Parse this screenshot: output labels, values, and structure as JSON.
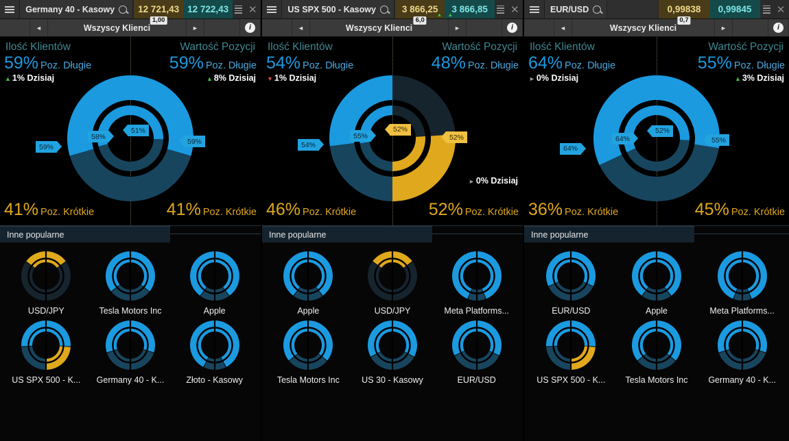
{
  "nav": {
    "clients_label": "Wszyscy Klienci",
    "prev_icon": "◄",
    "next_icon": "►",
    "info_icon": "i"
  },
  "labels": {
    "clients_count": "Ilość Klientów",
    "position_value": "Wartość Pozycji",
    "long": "Poz. Długie",
    "short": "Poz. Krótkie",
    "today": "Dzisiaj",
    "popular": "Inne popularne"
  },
  "colors": {
    "long_blue": "#1b9ae0",
    "long_blue_dim": "#18455e",
    "short_gold": "#e0a81c",
    "short_dark": "#16242e",
    "up_green": "#3cc13c",
    "down_red": "#e04646",
    "flat_gray": "#9a9a9a",
    "bid_bg": "#4a3c18",
    "ask_bg": "#154a4a"
  },
  "panels": [
    {
      "symbol": "Germany 40 - Kasowy",
      "bid": "12 721,43",
      "ask": "12 722,43",
      "spread": "1,00",
      "bid_dir": "none",
      "ask_dir": "none",
      "left": {
        "header": "Ilość Klientów",
        "long_pct": "59%",
        "short_pct": "41%",
        "change": "1%",
        "change_dir": "up",
        "outer_tag": "59%",
        "inner_tag": "58%",
        "long_value": 59,
        "inner_value": 58
      },
      "right": {
        "header": "Wartość Pozycji",
        "long_pct": "59%",
        "short_pct": "41%",
        "change": "8%",
        "change_dir": "up",
        "change_low": false,
        "outer_tag": "59%",
        "inner_tag": "51%",
        "long_value": 59,
        "inner_value": 51
      },
      "popular": [
        {
          "name": "USD/JPY",
          "long": 30,
          "side": "short"
        },
        {
          "name": "Tesla Motors Inc",
          "long": 72,
          "side": "long"
        },
        {
          "name": "Apple",
          "long": 80,
          "side": "long"
        },
        {
          "name": "US SPX 500 - K...",
          "long": 52,
          "side": "mixed"
        },
        {
          "name": "Germany 40 - K...",
          "long": 60,
          "side": "long"
        },
        {
          "name": "Złoto - Kasowy",
          "long": 85,
          "side": "long"
        }
      ]
    },
    {
      "symbol": "US SPX 500 - Kasowy",
      "bid": "3 866,25",
      "ask": "3 866,85",
      "spread": "6,0",
      "bid_dir": "up",
      "ask_dir": "up",
      "left": {
        "header": "Ilość Klientów",
        "long_pct": "54%",
        "short_pct": "46%",
        "change": "1%",
        "change_dir": "down",
        "outer_tag": "54%",
        "inner_tag": "55%",
        "long_value": 54,
        "inner_value": 55
      },
      "right": {
        "header": "Wartość Pozycji",
        "long_pct": "48%",
        "short_pct": "52%",
        "change": "0%",
        "change_dir": "flat",
        "change_low": true,
        "outer_tag": "52%",
        "inner_tag": "52%",
        "long_value": 48,
        "inner_value": 48
      },
      "popular": [
        {
          "name": "Apple",
          "long": 80,
          "side": "long"
        },
        {
          "name": "USD/JPY",
          "long": 30,
          "side": "short"
        },
        {
          "name": "Meta Platforms...",
          "long": 88,
          "side": "long"
        },
        {
          "name": "Tesla Motors Inc",
          "long": 72,
          "side": "long"
        },
        {
          "name": "US 30 - Kasowy",
          "long": 66,
          "side": "long"
        },
        {
          "name": "EUR/USD",
          "long": 64,
          "side": "long"
        }
      ]
    },
    {
      "symbol": "EUR/USD",
      "bid": "0,99838",
      "ask": "0,99845",
      "spread": "0,7",
      "bid_dir": "none",
      "ask_dir": "none",
      "left": {
        "header": "Ilość Klientów",
        "long_pct": "64%",
        "short_pct": "36%",
        "change": "0%",
        "change_dir": "flat",
        "outer_tag": "64%",
        "inner_tag": "64%",
        "long_value": 64,
        "inner_value": 64
      },
      "right": {
        "header": "Wartość Pozycji",
        "long_pct": "55%",
        "short_pct": "45%",
        "change": "3%",
        "change_dir": "up",
        "change_low": false,
        "outer_tag": "55%",
        "inner_tag": "52%",
        "long_value": 55,
        "inner_value": 52
      },
      "popular": [
        {
          "name": "EUR/USD",
          "long": 64,
          "side": "long"
        },
        {
          "name": "Apple",
          "long": 80,
          "side": "long"
        },
        {
          "name": "Meta Platforms...",
          "long": 88,
          "side": "long"
        },
        {
          "name": "US SPX 500 - K...",
          "long": 52,
          "side": "mixed"
        },
        {
          "name": "Tesla Motors Inc",
          "long": 72,
          "side": "long"
        },
        {
          "name": "Germany 40 - K...",
          "long": 60,
          "side": "long"
        }
      ]
    }
  ]
}
